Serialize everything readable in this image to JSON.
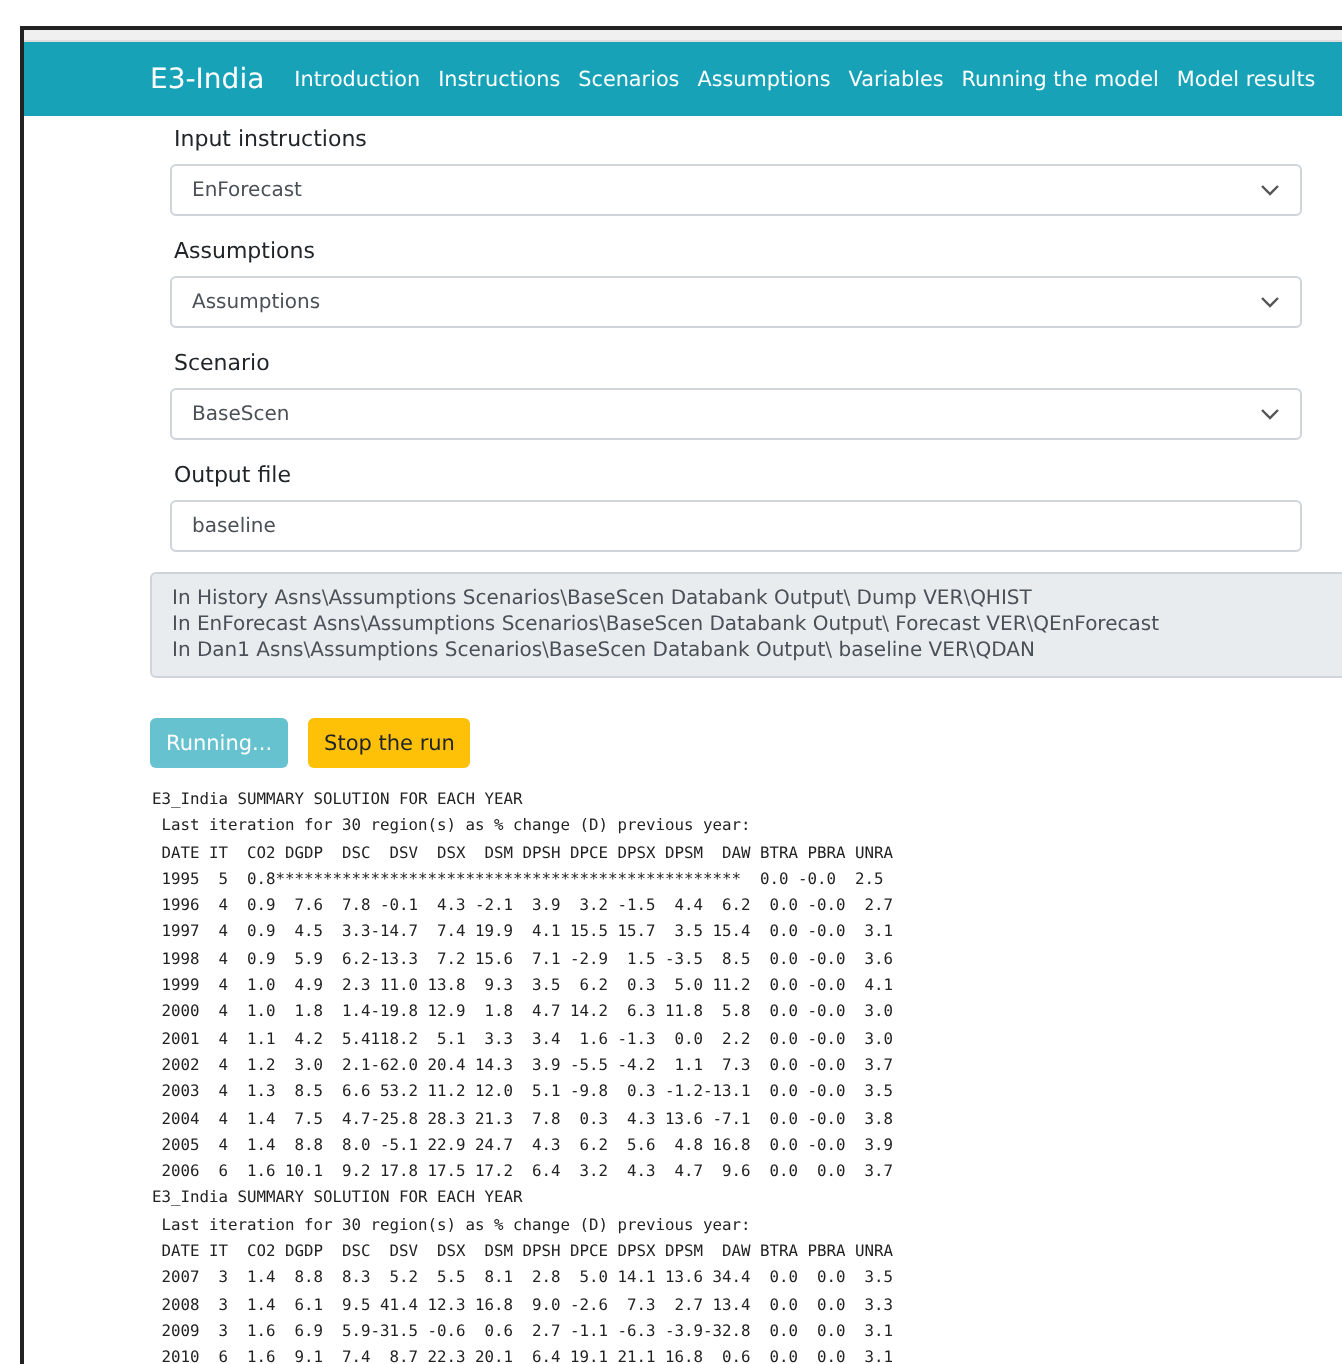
{
  "navbar": {
    "brand": "E3-India",
    "links": [
      "Introduction",
      "Instructions",
      "Scenarios",
      "Assumptions",
      "Variables",
      "Running the model",
      "Model results"
    ]
  },
  "fields": [
    {
      "kind": "select",
      "label": "Input instructions",
      "value": "EnForecast"
    },
    {
      "kind": "select",
      "label": "Assumptions",
      "value": "Assumptions"
    },
    {
      "kind": "select",
      "label": "Scenario",
      "value": "BaseScen"
    },
    {
      "kind": "input",
      "label": "Output file",
      "value": "baseline"
    }
  ],
  "info_lines": [
    "In History Asns\\Assumptions Scenarios\\BaseScen Databank Output\\ Dump VER\\QHIST",
    "In EnForecast Asns\\Assumptions Scenarios\\BaseScen Databank Output\\ Forecast VER\\QEnForecast",
    "In Dan1 Asns\\Assumptions Scenarios\\BaseScen Databank Output\\ baseline VER\\QDAN"
  ],
  "buttons": [
    {
      "kind": "info",
      "label": "Running...",
      "disabled": true
    },
    {
      "kind": "warning",
      "label": "Stop the run",
      "disabled": false
    }
  ],
  "output_lines": [
    "E3_India SUMMARY SOLUTION FOR EACH YEAR",
    " Last iteration for 30 region(s) as % change (D) previous year:",
    " DATE IT  CO2 DGDP  DSC  DSV  DSX  DSM DPSH DPCE DPSX DPSM  DAW BTRA PBRA UNRA",
    " 1995  5  0.8*************************************************  0.0 -0.0  2.5",
    " 1996  4  0.9  7.6  7.8 -0.1  4.3 -2.1  3.9  3.2 -1.5  4.4  6.2  0.0 -0.0  2.7",
    " 1997  4  0.9  4.5  3.3-14.7  7.4 19.9  4.1 15.5 15.7  3.5 15.4  0.0 -0.0  3.1",
    " 1998  4  0.9  5.9  6.2-13.3  7.2 15.6  7.1 -2.9  1.5 -3.5  8.5  0.0 -0.0  3.6",
    " 1999  4  1.0  4.9  2.3 11.0 13.8  9.3  3.5  6.2  0.3  5.0 11.2  0.0 -0.0  4.1",
    " 2000  4  1.0  1.8  1.4-19.8 12.9  1.8  4.7 14.2  6.3 11.8  5.8  0.0 -0.0  3.0",
    " 2001  4  1.1  4.2  5.4118.2  5.1  3.3  3.4  1.6 -1.3  0.0  2.2  0.0 -0.0  3.0",
    " 2002  4  1.2  3.0  2.1-62.0 20.4 14.3  3.9 -5.5 -4.2  1.1  7.3  0.0 -0.0  3.7",
    " 2003  4  1.3  8.5  6.6 53.2 11.2 12.0  5.1 -9.8  0.3 -1.2-13.1  0.0 -0.0  3.5",
    " 2004  4  1.4  7.5  4.7-25.8 28.3 21.3  7.8  0.3  4.3 13.6 -7.1  0.0 -0.0  3.8",
    " 2005  4  1.4  8.8  8.0 -5.1 22.9 24.7  4.3  6.2  5.6  4.8 16.8  0.0 -0.0  3.9",
    " 2006  6  1.6 10.1  9.2 17.8 17.5 17.2  6.4  3.2  4.3  4.7  9.6  0.0  0.0  3.7",
    "E3_India SUMMARY SOLUTION FOR EACH YEAR",
    " Last iteration for 30 region(s) as % change (D) previous year:",
    " DATE IT  CO2 DGDP  DSC  DSV  DSX  DSM DPSH DPCE DPSX DPSM  DAW BTRA PBRA UNRA",
    " 2007  3  1.4  8.8  8.3  5.2  5.5  8.1  2.8  5.0 14.1 13.6 34.4  0.0  0.0  3.5",
    " 2008  3  1.4  6.1  9.5 41.4 12.3 16.8  9.0 -2.6  7.3  2.7 13.4  0.0  0.0  3.3",
    " 2009  3  1.6  6.9  5.9-31.5 -0.6  0.6  2.7 -1.1 -6.3 -3.9-32.8  0.0  0.0  3.1",
    " 2010  6  1.6  9.1  7.4  8.7 22.3 20.1  6.4 19.1 21.1 16.8  0.6  0.0  0.0  3.1"
  ]
}
